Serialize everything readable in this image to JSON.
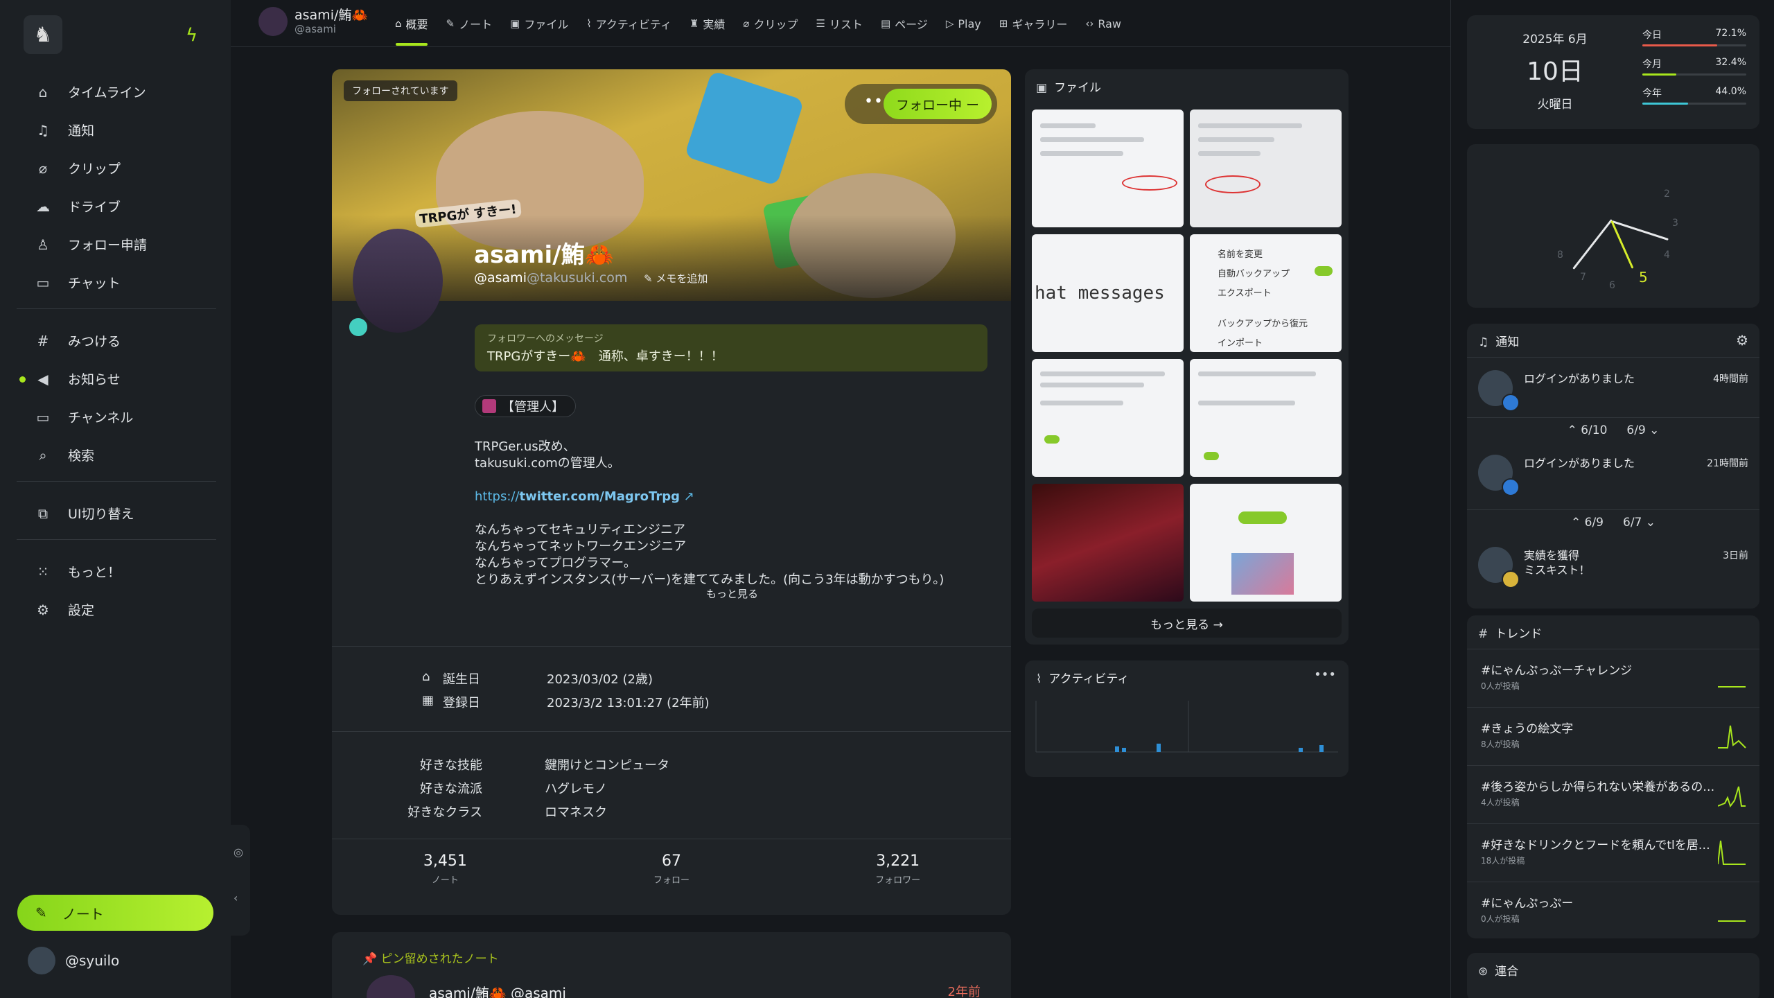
{
  "nav": {
    "items": [
      {
        "icon": "home-icon",
        "label": "タイムライン"
      },
      {
        "icon": "bell-icon",
        "label": "通知"
      },
      {
        "icon": "paperclip-icon",
        "label": "クリップ"
      },
      {
        "icon": "cloud-icon",
        "label": "ドライブ"
      },
      {
        "icon": "user-plus-icon",
        "label": "フォロー申請"
      },
      {
        "icon": "chat-icon",
        "label": "チャット"
      }
    ],
    "items2": [
      {
        "icon": "hash-icon",
        "label": "みつける"
      },
      {
        "icon": "megaphone-icon",
        "label": "お知らせ"
      },
      {
        "icon": "tv-icon",
        "label": "チャンネル"
      },
      {
        "icon": "search-icon",
        "label": "検索"
      }
    ],
    "items3": [
      {
        "icon": "device-switch-icon",
        "label": "UI切り替え"
      }
    ],
    "items4": [
      {
        "icon": "grid-icon",
        "label": "もっと！"
      },
      {
        "icon": "gear-icon",
        "label": "設定"
      }
    ],
    "note_button": "ノート",
    "me": "@syuilo"
  },
  "topbar": {
    "user_name": "asami/鮪🦀",
    "user_handle": "@asami",
    "tabs": [
      {
        "icon": "⌂",
        "label": "概要",
        "active": true
      },
      {
        "icon": "✎",
        "label": "ノート"
      },
      {
        "icon": "▣",
        "label": "ファイル"
      },
      {
        "icon": "⌇",
        "label": "アクティビティ"
      },
      {
        "icon": "♜",
        "label": "実績"
      },
      {
        "icon": "⌀",
        "label": "クリップ"
      },
      {
        "icon": "☰",
        "label": "リスト"
      },
      {
        "icon": "▤",
        "label": "ページ"
      },
      {
        "icon": "▷",
        "label": "Play"
      },
      {
        "icon": "⊞",
        "label": "ギャラリー"
      },
      {
        "icon": "‹›",
        "label": "Raw"
      }
    ]
  },
  "profile": {
    "followed_badge": "フォローされています",
    "follow_button": "フォロー中 ー",
    "more": "•••",
    "trpg_tag": "TRPGが すきー!",
    "name": "asami/鮪🦀",
    "handle_user": "@asami",
    "handle_host": "@takusuki.com",
    "memo": "✎ メモを追加",
    "message_label": "フォロワーへのメッセージ",
    "message": "TRPGがすきー🦀　通称、卓すきー！！！",
    "role": "【管理人】",
    "bio_lines": [
      "TRPGer.us改め、",
      "takusuki.comの管理人。"
    ],
    "bio_link_prefix": "https://",
    "bio_link_domain": "twitter.com/MagroTrpg",
    "bio_lines2": [
      "なんちゃってセキュリティエンジニア",
      "なんちゃってネットワークエンジニア",
      "なんちゃってプログラマー。",
      "とりあえずインスタンス(サーバー)を建ててみました。(向こう3年は動かすつもり。)"
    ],
    "bio_more": "もっと見る",
    "birthday_label": "誕生日",
    "birthday": "2023/03/02 (2歳)",
    "joined_label": "登録日",
    "joined": "2023/3/2 13:01:27 (2年前)",
    "fields": [
      {
        "k": "好きな技能",
        "v": "鍵開けとコンピュータ"
      },
      {
        "k": "好きな流派",
        "v": "ハグレモノ"
      },
      {
        "k": "好きなクラス",
        "v": "ロマネスク"
      }
    ],
    "counts": [
      {
        "v": "3,451",
        "l": "ノート"
      },
      {
        "v": "67",
        "l": "フォロー"
      },
      {
        "v": "3,221",
        "l": "フォロワー"
      }
    ]
  },
  "pinned": {
    "label": "📌 ピン留めされたノート",
    "who": "asami/鮪🦀 @asami",
    "ago": "2年前"
  },
  "files": {
    "title": "ファイル",
    "chat_text": "hat messages",
    "menu": [
      "名前を変更",
      "自動バックアップ",
      "エクスポート",
      "バックアップから復元",
      "インポート"
    ],
    "more": "もっと見る →"
  },
  "activity": {
    "title": "アクティビティ",
    "more": "•••"
  },
  "calendar": {
    "ym": "2025年 6月",
    "day": "10日",
    "weekday": "火曜日",
    "bars": [
      {
        "label": "今日",
        "pct": "72.1%",
        "value": 72.1,
        "color": "#e85a4a"
      },
      {
        "label": "今月",
        "pct": "32.4%",
        "value": 32.4,
        "color": "#a8e61d"
      },
      {
        "label": "今年",
        "pct": "44.0%",
        "value": 44.0,
        "color": "#3ec6d6"
      }
    ]
  },
  "clock": {
    "five": "5"
  },
  "notifications": {
    "title": "通知",
    "rows": [
      {
        "text": "ログインがありました",
        "ago": "4時間前"
      },
      {
        "text": "ログインがありました",
        "ago": "21時間前"
      },
      {
        "text": "実績を獲得\nミスキスト！",
        "ago": "3日前"
      }
    ],
    "dividers": [
      [
        "⌃ 6/10",
        "6/9 ⌄"
      ],
      [
        "⌃ 6/9",
        "6/7 ⌄"
      ]
    ]
  },
  "trends": {
    "title": "トレンド",
    "rows": [
      {
        "tag": "#にゃんぷっぷーチャレンジ",
        "sub": "0人が投稿"
      },
      {
        "tag": "#きょうの絵文字",
        "sub": "8人が投稿"
      },
      {
        "tag": "#後ろ姿からしか得られない栄養があるの…",
        "sub": "4人が投稿"
      },
      {
        "tag": "#好きなドリンクとフードを頼んでtlを居…",
        "sub": "18人が投稿"
      },
      {
        "tag": "#にゃんぷっぷー",
        "sub": "0人が投稿"
      }
    ]
  },
  "federation": {
    "title": "連合"
  }
}
